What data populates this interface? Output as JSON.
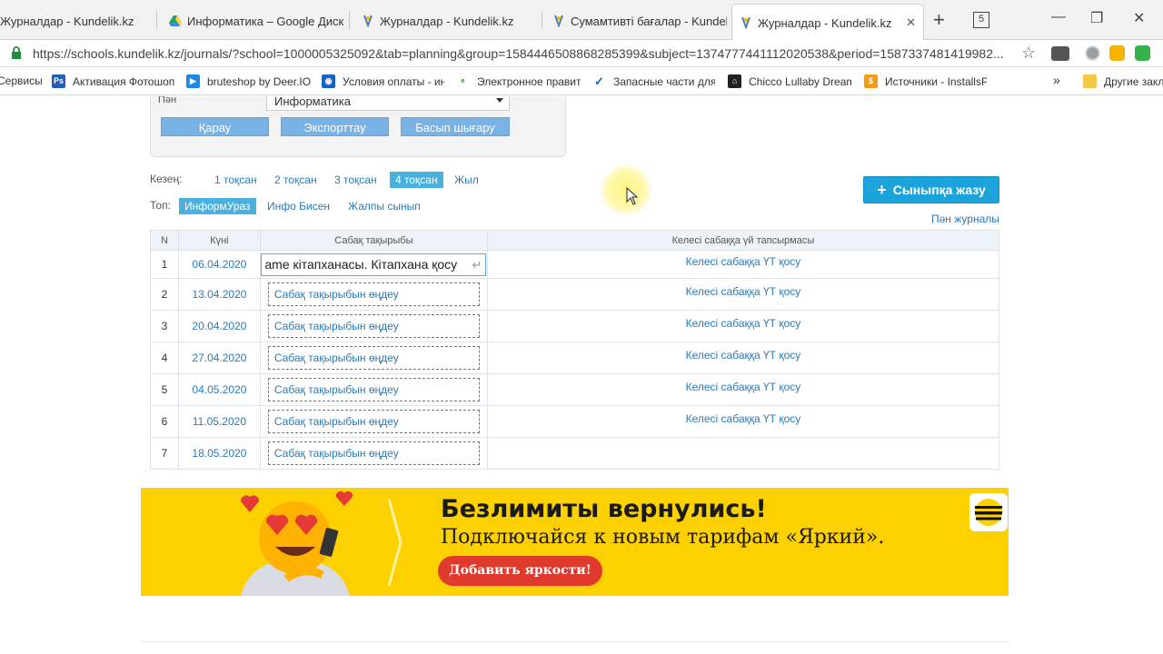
{
  "browser": {
    "tabs": [
      {
        "title": "Журналдар - Kundelik.kz",
        "icon": "kundelik-icon"
      },
      {
        "title": "Информатика – Google Диск",
        "icon": "google-drive-icon"
      },
      {
        "title": "Журналдар - Kundelik.kz",
        "icon": "kundelik-icon"
      },
      {
        "title": "Сумамтивті бағалар - Kundelik.",
        "icon": "kundelik-icon"
      },
      {
        "title": "Журналдар - Kundelik.kz",
        "icon": "kundelik-icon",
        "close": "✕"
      }
    ],
    "new_tab": "+",
    "tab_count": "5",
    "window_controls": {
      "minimize": "—",
      "maximize": "❐",
      "close": "✕"
    },
    "url": "https://schools.kundelik.kz/journals/?school=1000005325092&tab=planning&group=1584446508868285399&subject=1374777441112020538&period=1587337481419982..."
  },
  "bookmarks": [
    {
      "label": "Сервисы",
      "icon": "apps-icon"
    },
    {
      "label": "Активация Фотошоп",
      "icon": "photoshop-icon"
    },
    {
      "label": "bruteshop by Deer.IO",
      "icon": "deerio-icon"
    },
    {
      "label": "Условия оплаты - ин",
      "icon": "info-icon"
    },
    {
      "label": "Электронное правит",
      "icon": "egov-icon"
    },
    {
      "label": "Запасные части для",
      "icon": "check-icon"
    },
    {
      "label": "Chicco Lullaby Dream",
      "icon": "chicco-icon"
    },
    {
      "label": "Источники - InstallsP",
      "icon": "installs-icon"
    },
    {
      "label": "»",
      "icon": ""
    },
    {
      "label": "Другие закл",
      "icon": "folder-icon"
    }
  ],
  "filters": {
    "subject_label": "Пән",
    "subject_value": "Информатика",
    "buttons": [
      "Қарау",
      "Экспорттау",
      "Басып шығару"
    ]
  },
  "period": {
    "label": "Кезең:",
    "options": [
      "1 тоқсан",
      "2 тоқсан",
      "3 тоқсан",
      "4 тоқсан",
      "Жыл"
    ],
    "selected": "4 тоқсан"
  },
  "group": {
    "label": "Топ:",
    "options": [
      "ИнформУраз",
      "Инфо Бисен",
      "Жалпы сынып"
    ],
    "selected": "ИнформУраз"
  },
  "actions": {
    "record_button": "Сыныпқа жазу",
    "subject_journal_link": "Пән журналы"
  },
  "table": {
    "headers": [
      "N",
      "Күні",
      "Сабақ тақырыбы",
      "Келесі сабаққа үй тапсырмасы"
    ],
    "rows": [
      {
        "n": "1",
        "date": "06.04.2020",
        "topic": "аme кітапханасы. Кітапхана қосу",
        "homework": "Келесі сабаққа ҮТ қосу",
        "editing": true
      },
      {
        "n": "2",
        "date": "13.04.2020",
        "topic": "Сабақ тақырыбын өңдеу",
        "homework": "Келесі сабаққа ҮТ қосу"
      },
      {
        "n": "3",
        "date": "20.04.2020",
        "topic": "Сабақ тақырыбын өңдеу",
        "homework": "Келесі сабаққа ҮТ қосу"
      },
      {
        "n": "4",
        "date": "27.04.2020",
        "topic": "Сабақ тақырыбын өңдеу",
        "homework": "Келесі сабаққа ҮТ қосу"
      },
      {
        "n": "5",
        "date": "04.05.2020",
        "topic": "Сабақ тақырыбын өңдеу",
        "homework": "Келесі сабаққа ҮТ қосу"
      },
      {
        "n": "6",
        "date": "11.05.2020",
        "topic": "Сабақ тақырыбын өңдеу",
        "homework": "Келесі сабаққа ҮТ қосу"
      },
      {
        "n": "7",
        "date": "18.05.2020",
        "topic": "Сабақ тақырыбын өңдеу",
        "homework": ""
      }
    ]
  },
  "banner": {
    "headline": "Безлимиты вернулись!",
    "subline": "Подключайся к новым тарифам «Яркий».",
    "cta": "Добавить яркости!",
    "colors": {
      "background": "#fdd000",
      "cta": "#e03a2e"
    }
  },
  "colors": {
    "accent": "#1ba3dc",
    "link": "#2a7ab8",
    "selected": "#4ab0df",
    "button": "#79b2e4"
  }
}
